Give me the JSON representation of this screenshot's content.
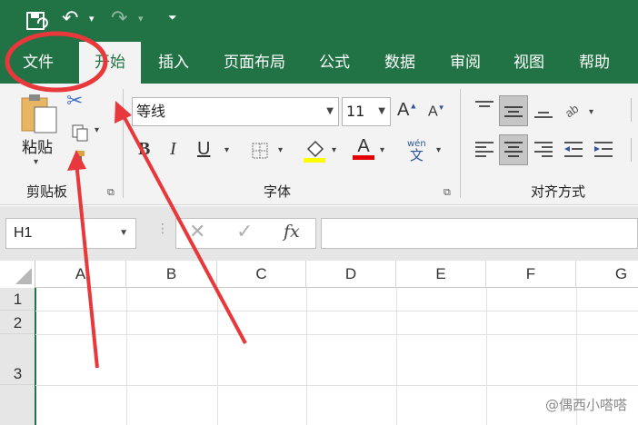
{
  "ribbon_tabs": [
    "文件",
    "开始",
    "插入",
    "页面布局",
    "公式",
    "数据",
    "审阅",
    "视图",
    "帮助"
  ],
  "clipboard": {
    "paste_label": "粘贴",
    "group_label": "剪贴板"
  },
  "font": {
    "name": "等线",
    "size": "11",
    "group_label": "字体",
    "phonetic_top": "wén",
    "phonetic_bottom": "文"
  },
  "alignment": {
    "group_label": "对齐方式"
  },
  "formula_bar": {
    "name_box": "H1",
    "fx": "fx"
  },
  "columns": [
    "A",
    "B",
    "C",
    "D",
    "E",
    "F",
    "G"
  ],
  "rows": [
    "1",
    "2",
    "3"
  ],
  "watermark": "@偶西小嗒嗒",
  "colors": {
    "excel_green": "#217346",
    "annotation_red": "#e8383b",
    "font_color_red": "#e60000",
    "fill_yellow": "#ffff00"
  }
}
